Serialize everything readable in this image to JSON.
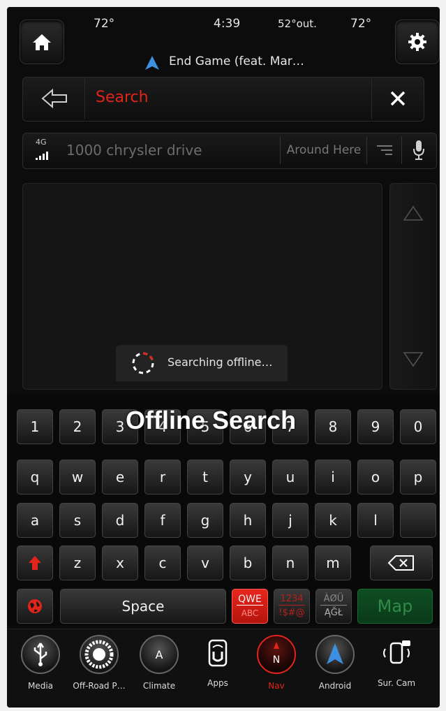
{
  "header": {
    "temp_left": "72°",
    "time": "4:39",
    "temp_outside": "52°out.",
    "temp_right": "72°",
    "now_playing": "End Game (feat. Mar…"
  },
  "search": {
    "label": "Search"
  },
  "address": {
    "signal_label": "4G",
    "query": "1000 chrysler drive",
    "scope_button": "Around Here"
  },
  "status": {
    "searching_text": "Searching offline…"
  },
  "overlay": {
    "title": "Offline Search"
  },
  "keyboard": {
    "row1": [
      "1",
      "2",
      "3",
      "4",
      "5",
      "6",
      "7",
      "8",
      "9",
      "0"
    ],
    "row2": [
      "q",
      "w",
      "e",
      "r",
      "t",
      "y",
      "u",
      "i",
      "o",
      "p"
    ],
    "row3": [
      "a",
      "s",
      "d",
      "f",
      "g",
      "h",
      "j",
      "k",
      "l",
      ""
    ],
    "row4": [
      "z",
      "x",
      "c",
      "v",
      "b",
      "n",
      "m"
    ],
    "space": "Space",
    "layout_qwe": "QWE",
    "layout_abc": "ABC",
    "layout_num": "1234",
    "layout_sym": "!$#@",
    "layout_intl_top": "ÀØÜ",
    "layout_intl_bottom": "ĄĞŁ",
    "map": "Map"
  },
  "dock": [
    {
      "label": "Media",
      "icon": "usb-icon"
    },
    {
      "label": "Off-Road P…",
      "icon": "tire-icon"
    },
    {
      "label": "Climate",
      "icon": "climate-icon"
    },
    {
      "label": "Apps",
      "icon": "apps-icon"
    },
    {
      "label": "Nav",
      "icon": "compass-icon"
    },
    {
      "label": "Android",
      "icon": "android-auto-icon"
    },
    {
      "label": "Sur. Cam",
      "icon": "camera-icon"
    }
  ],
  "colors": {
    "accent_red": "#e3241b",
    "map_green": "#0f4e23"
  }
}
